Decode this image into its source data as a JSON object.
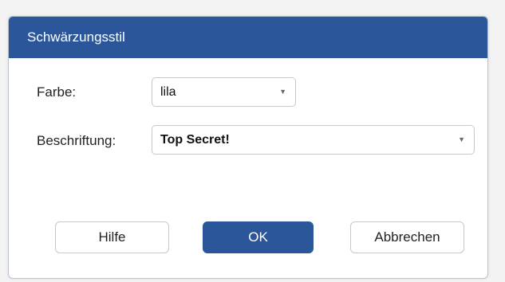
{
  "dialog": {
    "title": "Schwärzungsstil"
  },
  "form": {
    "color_label": "Farbe:",
    "color_value": "lila",
    "caption_label": "Beschriftung:",
    "caption_value": "Top Secret!"
  },
  "icons": {
    "dropdown": "chevron-down-icon",
    "dropdown_glyph": "▼"
  },
  "buttons": {
    "help": "Hilfe",
    "ok": "OK",
    "cancel": "Abbrechen"
  },
  "colors": {
    "accent": "#2b579a"
  }
}
